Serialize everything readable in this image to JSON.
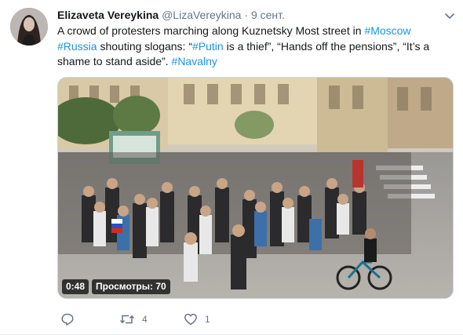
{
  "tweet": {
    "author_name": "Elizaveta Vereykina",
    "author_handle": "@LizaVereykina",
    "separator": "·",
    "time": "9 сент.",
    "text_parts": {
      "p1": "A crowd of protesters marching along Kuznetsky Most street in ",
      "tag_moscow": "#Moscow",
      "sp1": " ",
      "tag_russia": "#Russia",
      "p2": " shouting slogans: “",
      "tag_putin": "#Putin",
      "p3": " is a thief”, “Hands off the pensions”, “It’s a shame to stand aside”. ",
      "tag_navalny": "#Navalny"
    },
    "video": {
      "duration": "0:48",
      "views": "Просмотры: 70"
    },
    "actions": {
      "reply_count": "",
      "retweet_count": "4",
      "like_count": "1"
    }
  },
  "colors": {
    "link": "#1b95e0",
    "secondary_text": "#657786",
    "primary_text": "#14171a"
  },
  "icons": [
    "chevron-down-icon",
    "reply-icon",
    "retweet-icon",
    "like-icon"
  ]
}
